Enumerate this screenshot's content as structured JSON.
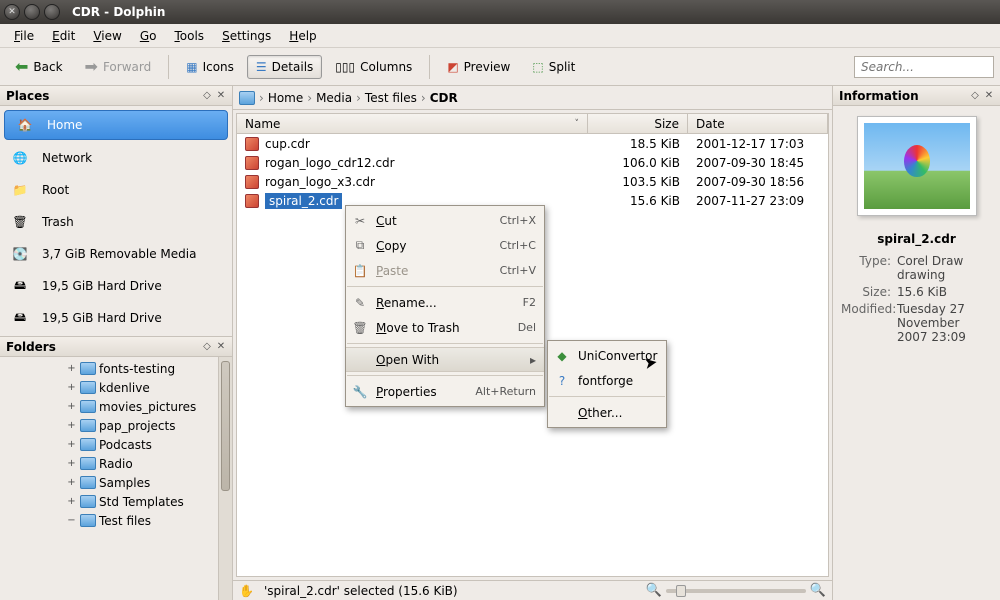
{
  "window": {
    "title": "CDR - Dolphin"
  },
  "menubar": [
    "File",
    "Edit",
    "View",
    "Go",
    "Tools",
    "Settings",
    "Help"
  ],
  "toolbar": {
    "back": "Back",
    "forward": "Forward",
    "icons": "Icons",
    "details": "Details",
    "columns": "Columns",
    "preview": "Preview",
    "split": "Split",
    "search_placeholder": "Search..."
  },
  "places": {
    "title": "Places",
    "items": [
      {
        "label": "Home",
        "icon": "home",
        "selected": true
      },
      {
        "label": "Network",
        "icon": "network"
      },
      {
        "label": "Root",
        "icon": "root"
      },
      {
        "label": "Trash",
        "icon": "trash"
      },
      {
        "label": "3,7 GiB Removable Media",
        "icon": "removable"
      },
      {
        "label": "19,5 GiB Hard Drive",
        "icon": "hdd"
      },
      {
        "label": "19,5 GiB Hard Drive",
        "icon": "hdd"
      }
    ]
  },
  "folders": {
    "title": "Folders",
    "items": [
      "fonts-testing",
      "kdenlive",
      "movies_pictures",
      "pap_projects",
      "Podcasts",
      "Radio",
      "Samples",
      "Std Templates",
      "Test files"
    ]
  },
  "breadcrumb": [
    "Home",
    "Media",
    "Test files",
    "CDR"
  ],
  "filelist": {
    "cols": {
      "name": "Name",
      "size": "Size",
      "date": "Date"
    },
    "rows": [
      {
        "name": "cup.cdr",
        "size": "18.5 KiB",
        "date": "2001-12-17 17:03"
      },
      {
        "name": "rogan_logo_cdr12.cdr",
        "size": "106.0 KiB",
        "date": "2007-09-30 18:45"
      },
      {
        "name": "rogan_logo_x3.cdr",
        "size": "103.5 KiB",
        "date": "2007-09-30 18:56"
      },
      {
        "name": "spiral_2.cdr",
        "size": "15.6 KiB",
        "date": "2007-11-27 23:09",
        "selected": true
      }
    ],
    "status": "'spiral_2.cdr' selected (15.6 KiB)"
  },
  "info": {
    "title": "Information",
    "name": "spiral_2.cdr",
    "rows": [
      {
        "k": "Type:",
        "v": "Corel Draw drawing"
      },
      {
        "k": "Size:",
        "v": "15.6 KiB"
      },
      {
        "k": "Modified:",
        "v": "Tuesday 27 November 2007 23:09"
      }
    ]
  },
  "ctx": {
    "cut": "Cut",
    "cut_sc": "Ctrl+X",
    "copy": "Copy",
    "copy_sc": "Ctrl+C",
    "paste": "Paste",
    "paste_sc": "Ctrl+V",
    "rename": "Rename...",
    "rename_sc": "F2",
    "trash": "Move to Trash",
    "trash_sc": "Del",
    "openwith": "Open With",
    "properties": "Properties",
    "properties_sc": "Alt+Return",
    "uniconvertor": "UniConvertor",
    "fontforge": "fontforge",
    "other": "Other..."
  }
}
